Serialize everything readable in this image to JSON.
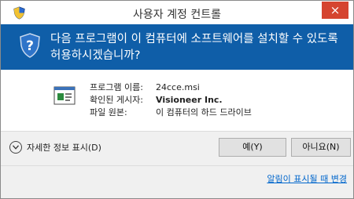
{
  "window": {
    "title": "사용자 계정 컨트롤",
    "close_glyph": "×"
  },
  "header": {
    "question": "다음 프로그램이 이 컴퓨터에 소프트웨어를 설치할 수 있도록 허용하시겠습니까?"
  },
  "program_info": {
    "rows": [
      {
        "label": "프로그램 이름:",
        "value": "24cce.msi",
        "bold": false
      },
      {
        "label": "확인된 게시자:",
        "value": "Visioneer Inc.",
        "bold": true
      },
      {
        "label": "파일 원본:",
        "value": "이 컴퓨터의 하드 드라이브",
        "bold": false
      }
    ]
  },
  "actions": {
    "show_details_label": "자세한 정보 표시(D)",
    "yes_label": "예(Y)",
    "no_label": "아니요(N)",
    "change_link": "알림이 표시될 때 변경"
  },
  "colors": {
    "header_bg": "#0f5ea8",
    "close_bg": "#d5442f",
    "link": "#0066cc"
  }
}
